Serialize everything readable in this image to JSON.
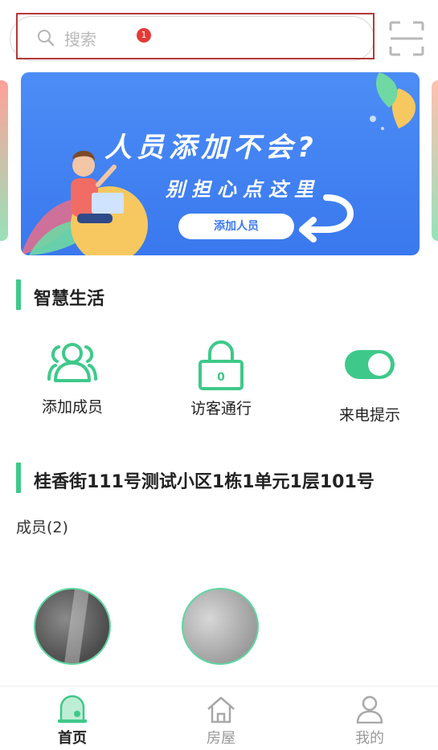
{
  "search": {
    "placeholder": "搜索",
    "badge_count": "1"
  },
  "banner": {
    "title": "人员添加不会?",
    "subtitle": "别担心点这里",
    "button_label": "添加人员"
  },
  "smart_life": {
    "title": "智慧生活",
    "actions": [
      {
        "label": "添加成员",
        "icon": "people-icon"
      },
      {
        "label": "访客通行",
        "icon": "padlock-icon",
        "lock_digit": "0"
      },
      {
        "label": "来电提示",
        "icon": "toggle-icon"
      }
    ]
  },
  "address": {
    "title": "桂香街111号测试小区1栋1单元1层101号"
  },
  "members": {
    "label": "成员(2)"
  },
  "tabs": [
    {
      "label": "首页",
      "icon": "home-icon",
      "active": true
    },
    {
      "label": "房屋",
      "icon": "house-icon",
      "active": false
    },
    {
      "label": "我的",
      "icon": "user-icon",
      "active": false
    }
  ],
  "colors": {
    "accent": "#3ec98a",
    "banner": "#3a78ee",
    "badge": "#e53935",
    "highlight": "#b33a3a"
  }
}
